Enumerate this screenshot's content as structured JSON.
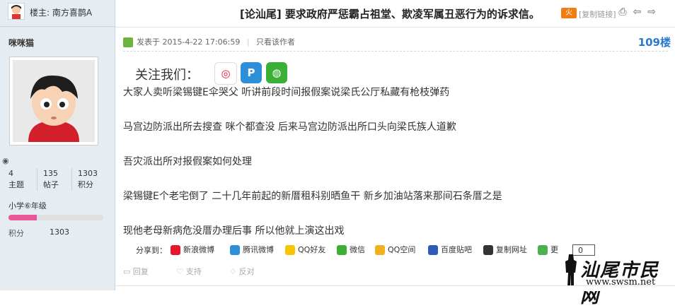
{
  "header": {
    "op_label": "楼主: 南方喜鹊A",
    "title": "[论汕尾] 要求政府严惩霸占祖堂、欺凌军属丑恶行为的诉求信。",
    "hot_badge": "火",
    "copy_link": "[复制链接]",
    "tool_icons": [
      "print-icon",
      "prev-icon",
      "next-icon"
    ]
  },
  "sidebar": {
    "username": "咪咪猫",
    "stats": [
      {
        "value": "4",
        "label": "主题"
      },
      {
        "value": "135",
        "label": "帖子"
      },
      {
        "value": "1303",
        "label": "积分"
      }
    ],
    "rank": "小学⑥年级",
    "rank_progress_percent": 30,
    "points_label": "积分",
    "points_value": "1303"
  },
  "post": {
    "posted_at": "发表于 2015-4-22 17:06:59",
    "only_author": "只看该作者",
    "floor": "109楼",
    "follow_label": "关注我们：",
    "paragraphs": [
      "大家人卖听梁锡键E伞哭父    听讲前段时间报假案说梁氏公厅私藏有枪枝弹药",
      "马宫边防派出所去搜查   咪个都查没   后来马宫边防派出所口头向梁氏族人道歉",
      "吾灾派出所对报假案如何处理",
      "梁锡键E个老宅倒了   二十几年前起的新厝租科别晒鱼干   新乡加油站落来那间石条厝之是",
      "现他老母新病危没厝办理后事    所以他就上演这出戏"
    ]
  },
  "share": {
    "label": "分享到：",
    "items": [
      {
        "label": "新浪微博",
        "color": "#e6162d"
      },
      {
        "label": "腾讯微博",
        "color": "#2d8fd8"
      },
      {
        "label": "QQ好友",
        "color": "#f6c700"
      },
      {
        "label": "微信",
        "color": "#3cb034"
      },
      {
        "label": "QQ空间",
        "color": "#f2b01e"
      },
      {
        "label": "百度贴吧",
        "color": "#2f5bb7"
      },
      {
        "label": "复制网址",
        "color": "#333333"
      },
      {
        "label": "更",
        "color": "#4caf50"
      }
    ],
    "count": "0"
  },
  "actions": [
    "回复",
    "支持",
    "反对"
  ],
  "watermark": {
    "text": "汕尾市民网",
    "url": "www.swsm.net"
  }
}
